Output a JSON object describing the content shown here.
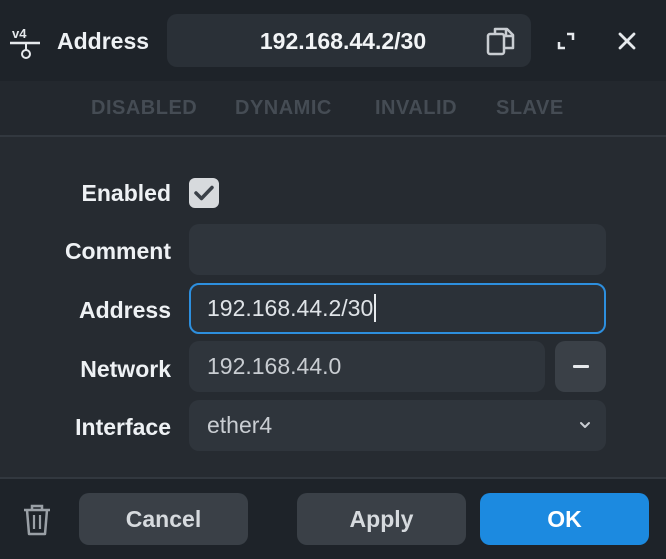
{
  "titlebar": {
    "icon": "ipv4-address-icon",
    "title": "Address",
    "address_display": "192.168.44.2/30",
    "copy_icon": "copy-icon",
    "maximize_icon": "maximize-icon",
    "close_icon": "close-icon"
  },
  "status_flags": [
    "DISABLED",
    "DYNAMIC",
    "INVALID",
    "SLAVE"
  ],
  "form": {
    "enabled_label": "Enabled",
    "enabled_checked": true,
    "comment_label": "Comment",
    "comment_value": "",
    "address_label": "Address",
    "address_value": "192.168.44.2/30",
    "network_label": "Network",
    "network_value": "192.168.44.0",
    "interface_label": "Interface",
    "interface_value": "ether4"
  },
  "footer": {
    "trash_icon": "trash-icon",
    "cancel_label": "Cancel",
    "apply_label": "Apply",
    "ok_label": "OK"
  },
  "colors": {
    "accent": "#1c8ae0",
    "focus_border": "#2d8fde",
    "background": "#23282e"
  }
}
